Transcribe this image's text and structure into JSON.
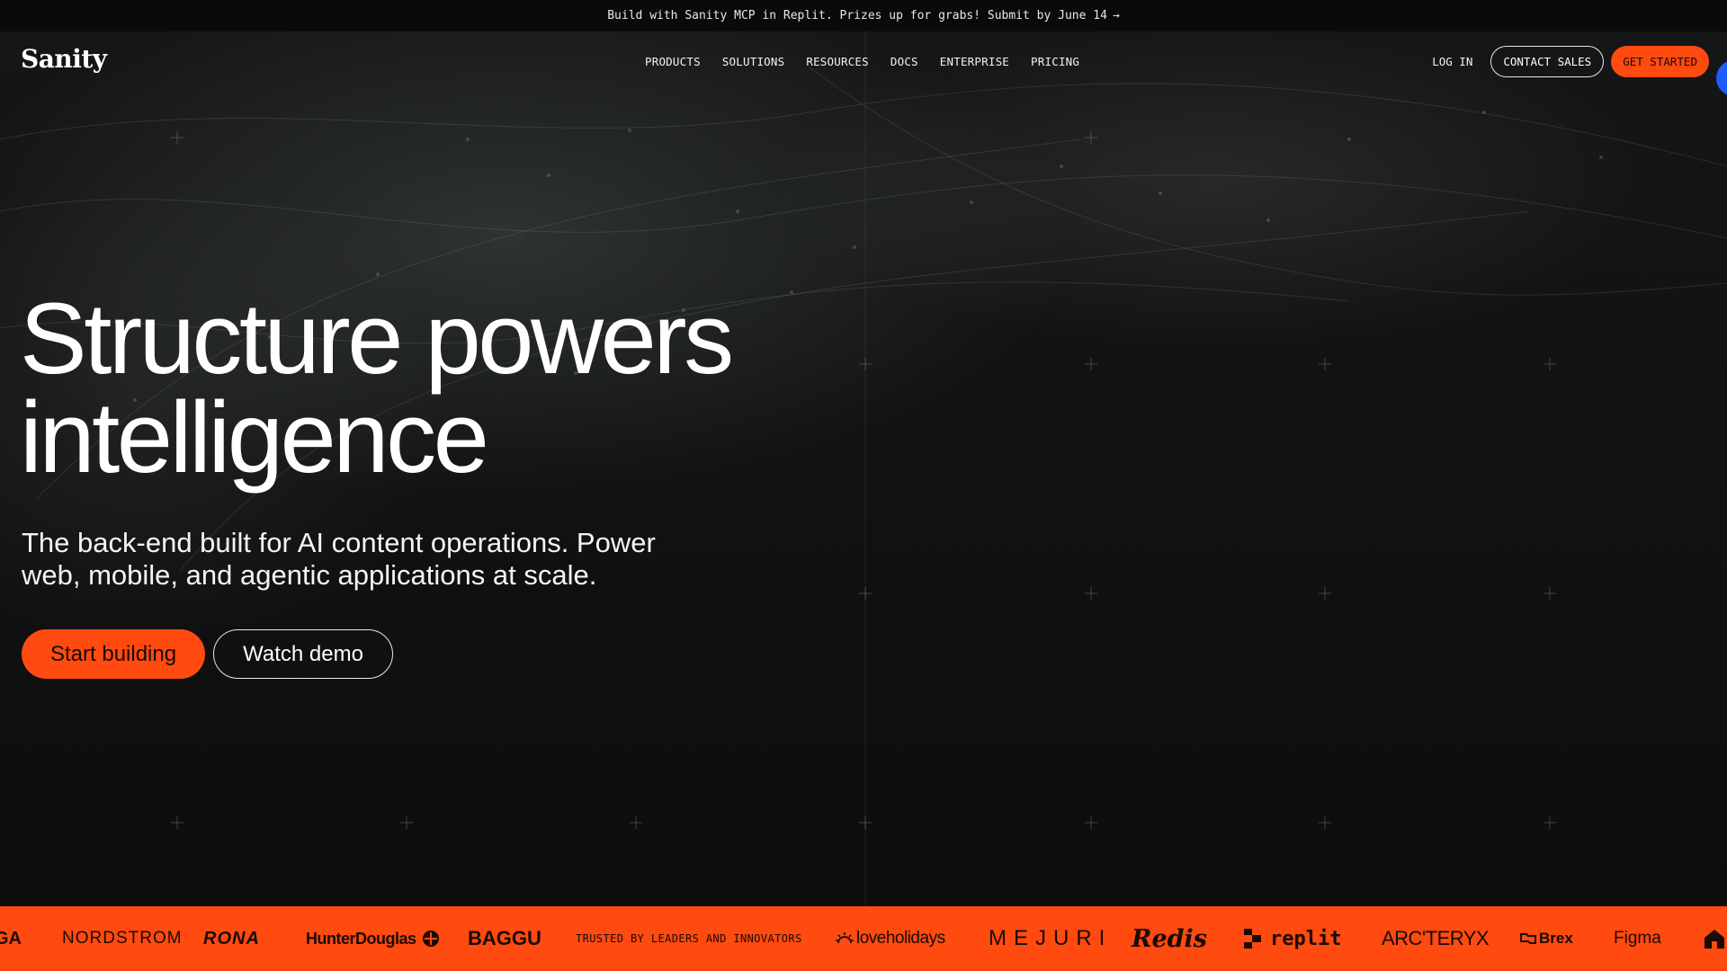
{
  "announcement": {
    "text": "Build with Sanity MCP in Replit. Prizes up for grabs! Submit by June 14",
    "arrow": "→"
  },
  "nav": {
    "logo": "Sanity",
    "links": [
      "PRODUCTS",
      "SOLUTIONS",
      "RESOURCES",
      "DOCS",
      "ENTERPRISE",
      "PRICING"
    ],
    "login": "LOG IN",
    "contact_sales": "CONTACT SALES",
    "get_started": "GET STARTED"
  },
  "hero": {
    "headline_line1": "Structure powers",
    "headline_line2": "intelligence",
    "subtitle_line1": "The back-end built for AI content operations. Power",
    "subtitle_line2": "web, mobile, and agentic applications at scale.",
    "primary_cta": "Start building",
    "secondary_cta": "Watch demo"
  },
  "logos": {
    "partial_left": "GA",
    "nordstrom": "NORDSTROM",
    "rona": "RONA",
    "hunter_douglas": "HunterDouglas",
    "baggu": "BAGGU",
    "trusted_label": "TRUSTED BY LEADERS AND INNOVATORS",
    "loveholidays": "loveholidays",
    "mejuri": "MEJURI",
    "redis": "Redis",
    "replit": "replit",
    "arcteryx": "ARC'TERYX",
    "brex": "Brex",
    "figma": "Figma"
  },
  "colors": {
    "accent_orange": "#ff4a10",
    "floating_button_blue": "#1f5cff",
    "background": "#0b0b0c"
  },
  "icons": [
    "arrow-right-icon",
    "hunter-douglas-mark-icon",
    "loveholidays-sun-icon",
    "replit-mark-icon",
    "brex-mark-icon",
    "home-icon"
  ]
}
